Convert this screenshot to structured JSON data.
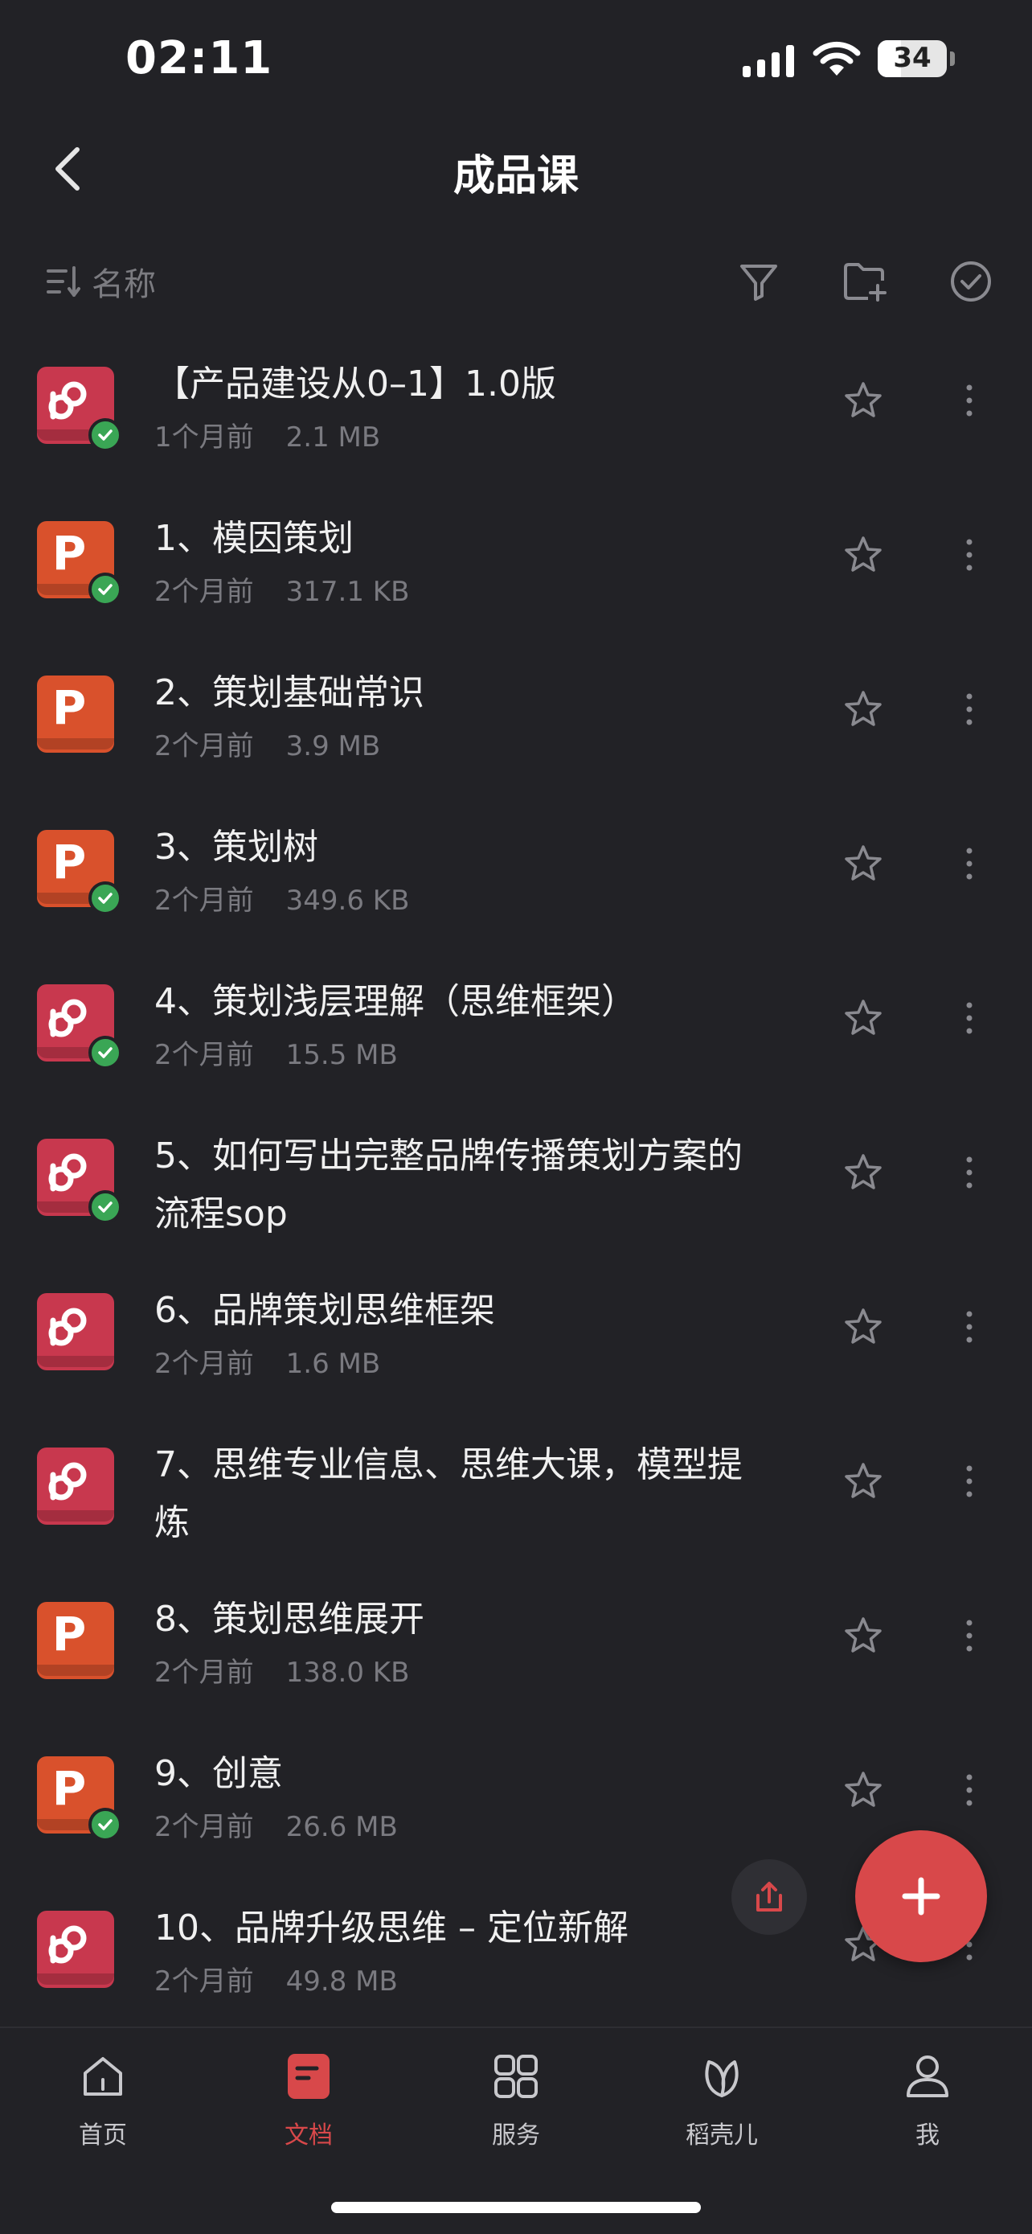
{
  "status_bar": {
    "time": "02:11",
    "battery": "34",
    "battery_level": 0.34
  },
  "nav": {
    "title": "成品课"
  },
  "toolbar": {
    "sort_label": "名称"
  },
  "files": [
    {
      "type": "pdf",
      "name": "【产品建设从0–1】1.0版",
      "time": "1个月前",
      "size": "2.1 MB",
      "synced": true
    },
    {
      "type": "ppt",
      "name": "1、模因策划",
      "time": "2个月前",
      "size": "317.1 KB",
      "synced": true
    },
    {
      "type": "ppt",
      "name": "2、策划基础常识",
      "time": "2个月前",
      "size": "3.9 MB",
      "synced": false
    },
    {
      "type": "ppt",
      "name": "3、策划树",
      "time": "2个月前",
      "size": "349.6 KB",
      "synced": true
    },
    {
      "type": "pdf",
      "name": "4、策划浅层理解（思维框架）",
      "time": "2个月前",
      "size": "15.5 MB",
      "synced": true
    },
    {
      "type": "pdf",
      "name": "5、如何写出完整品牌传播策划方案的流程sop",
      "time": "",
      "size": "",
      "synced": true
    },
    {
      "type": "pdf",
      "name": "6、品牌策划思维框架",
      "time": "2个月前",
      "size": "1.6 MB",
      "synced": false
    },
    {
      "type": "pdf",
      "name": "7、思维专业信息、思维大课，模型提炼",
      "time": "",
      "size": "",
      "synced": false
    },
    {
      "type": "ppt",
      "name": "8、策划思维展开",
      "time": "2个月前",
      "size": "138.0 KB",
      "synced": false
    },
    {
      "type": "ppt",
      "name": "9、创意",
      "time": "2个月前",
      "size": "26.6 MB",
      "synced": true
    },
    {
      "type": "pdf",
      "name": "10、品牌升级思维 – 定位新解",
      "time": "2个月前",
      "size": "49.8 MB",
      "synced": false
    }
  ],
  "tabs": [
    {
      "label": "首页",
      "icon": "home-icon",
      "active": false
    },
    {
      "label": "文档",
      "icon": "document-icon",
      "active": true
    },
    {
      "label": "服务",
      "icon": "grid-icon",
      "active": false
    },
    {
      "label": "稻壳儿",
      "icon": "leaf-icon",
      "active": false
    },
    {
      "label": "我",
      "icon": "user-icon",
      "active": false
    }
  ],
  "colors": {
    "accent": "#d8484a",
    "background": "#222226",
    "ppt": "#d9512c",
    "pdf": "#c8384e",
    "sync": "#3aa655"
  }
}
